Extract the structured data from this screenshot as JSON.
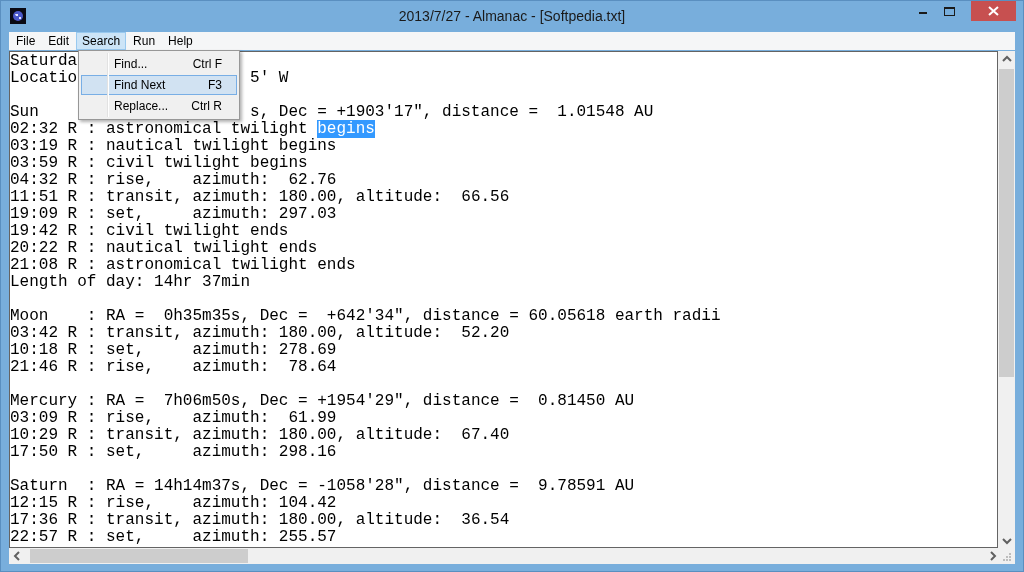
{
  "window": {
    "title": "2013/7/27 - Almanac - [Softpedia.txt]"
  },
  "menu_bar": [
    {
      "label": "File",
      "selected": false
    },
    {
      "label": "Edit",
      "selected": false
    },
    {
      "label": "Search",
      "selected": true
    },
    {
      "label": "Run",
      "selected": false
    },
    {
      "label": "Help",
      "selected": false
    }
  ],
  "dropdown": {
    "items": [
      {
        "label": "Find...",
        "shortcut": "Ctrl F",
        "selected": false
      },
      {
        "label": "Find Next",
        "shortcut": "F3",
        "selected": true
      },
      {
        "label": "Replace...",
        "shortcut": "Ctrl R",
        "selected": false
      }
    ]
  },
  "document": {
    "blocks": [
      [
        {
          "text": "Saturda"
        },
        {
          "text": "Locatio",
          "tail": "5' W"
        }
      ],
      [
        {
          "text": "Sun",
          "tail": "s, Dec = +1903'17\", distance =  1.01548 AU"
        },
        {
          "text": "02:32 R : astronomical twilight ",
          "selected_text": "begins"
        },
        {
          "text": "03:19 R : nautical twilight begins"
        },
        {
          "text": "03:59 R : civil twilight begins"
        },
        {
          "text": "04:32 R : rise,    azimuth:  62.76"
        },
        {
          "text": "11:51 R : transit, azimuth: 180.00, altitude:  66.56"
        },
        {
          "text": "19:09 R : set,     azimuth: 297.03"
        },
        {
          "text": "19:42 R : civil twilight ends"
        },
        {
          "text": "20:22 R : nautical twilight ends"
        },
        {
          "text": "21:08 R : astronomical twilight ends"
        },
        {
          "text": "Length of day: 14hr 37min"
        }
      ],
      [
        {
          "text": "Moon    : RA =  0h35m35s, Dec =  +642'34\", distance = 60.05618 earth radii"
        },
        {
          "text": "03:42 R : transit, azimuth: 180.00, altitude:  52.20"
        },
        {
          "text": "10:18 R : set,     azimuth: 278.69"
        },
        {
          "text": "21:46 R : rise,    azimuth:  78.64"
        }
      ],
      [
        {
          "text": "Mercury : RA =  7h06m50s, Dec = +1954'29\", distance =  0.81450 AU"
        },
        {
          "text": "03:09 R : rise,    azimuth:  61.99"
        },
        {
          "text": "10:29 R : transit, azimuth: 180.00, altitude:  67.40"
        },
        {
          "text": "17:50 R : set,     azimuth: 298.16"
        }
      ],
      [
        {
          "text": "Saturn  : RA = 14h14m37s, Dec = -1058'28\", distance =  9.78591 AU"
        },
        {
          "text": "12:15 R : rise,    azimuth: 104.42"
        },
        {
          "text": "17:36 R : transit, azimuth: 180.00, altitude:  36.54"
        },
        {
          "text": "22:57 R : set,     azimuth: 255.57"
        }
      ]
    ]
  }
}
